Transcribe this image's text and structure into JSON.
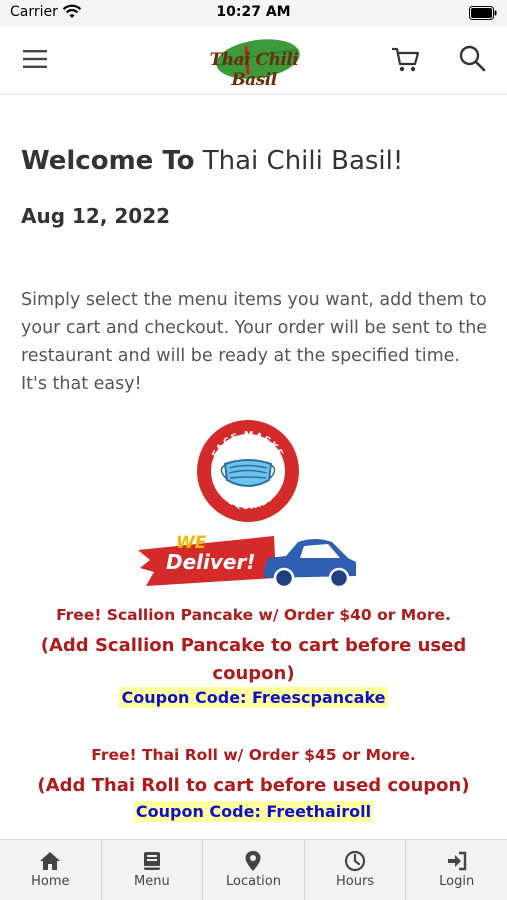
{
  "status_bar": {
    "carrier": "Carrier",
    "time": "10:27 AM"
  },
  "header": {
    "logo_text": "Thai Chili Basil",
    "icons": [
      "menu-icon",
      "cart-icon",
      "search-icon"
    ]
  },
  "welcome": {
    "bold": "Welcome To",
    "name": " Thai Chili Basil!"
  },
  "date": "Aug 12, 2022",
  "intro": "Simply select the menu items you want, add them to your cart and checkout. Your order will be sent to the restaurant and will be ready at the specified time. It's that easy!",
  "badges": {
    "mask_top": "FACE MASKS",
    "mask_bottom": "REQUIRED",
    "deliver_we": "WE",
    "deliver_text": "Deliver!"
  },
  "promos": [
    {
      "title": "Free! Scallion Pancake w/ Order $40 or More.",
      "note": "(Add Scallion Pancake to cart before used coupon)",
      "coupon": "Coupon Code: Freescpancake"
    },
    {
      "title": "Free! Thai Roll w/ Order $45 or More.",
      "note": "(Add Thai Roll to cart before used coupon)",
      "coupon": "Coupon Code: Freethairoll"
    }
  ],
  "tabs": [
    {
      "label": "Home",
      "icon": "home-icon"
    },
    {
      "label": "Menu",
      "icon": "book-icon"
    },
    {
      "label": "Location",
      "icon": "location-pin-icon"
    },
    {
      "label": "Hours",
      "icon": "clock-icon"
    },
    {
      "label": "Login",
      "icon": "login-icon"
    }
  ],
  "colors": {
    "promo_red": "#b01c1c",
    "coupon_blue": "#1010c8",
    "coupon_highlight": "#ffffa0",
    "badge_red": "#d42a2a",
    "car_blue": "#2f5fb0"
  }
}
